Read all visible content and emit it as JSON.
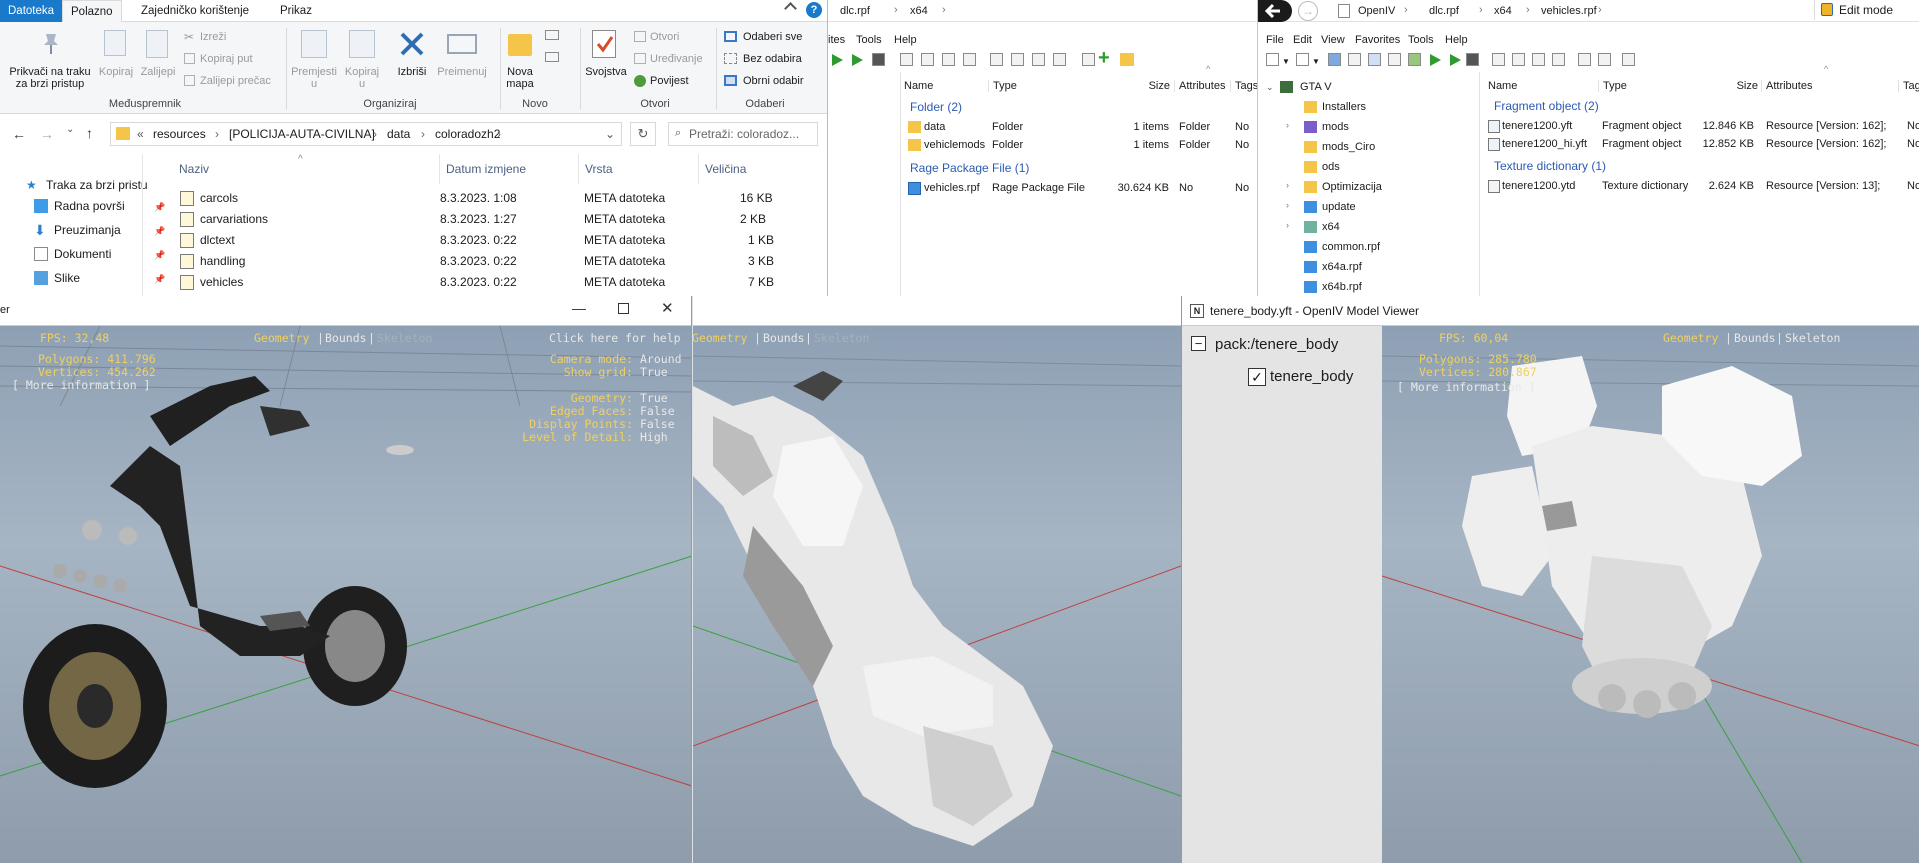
{
  "explorer": {
    "tabs": [
      "Datoteka",
      "Polazno",
      "Zajedničko korištenje",
      "Prikaz"
    ],
    "ribbon": {
      "pin_label": "Prikvači na traku\nza brzi pristup",
      "copy": "Kopiraj",
      "paste": "Zalijepi",
      "cut": "Izreži",
      "copy_path": "Kopiraj put",
      "paste_shortcut": "Zalijepi prečac",
      "group_clipboard": "Međuspremnik",
      "move_to": "Premjesti\nu",
      "copy_to": "Kopiraj\nu",
      "delete": "Izbriši",
      "rename": "Preimenuj",
      "group_organize": "Organiziraj",
      "new_folder": "Nova\nmapa",
      "group_new": "Novo",
      "properties": "Svojstva",
      "open": "Otvori",
      "edit": "Uređivanje",
      "history": "Povijest",
      "group_open": "Otvori",
      "select_all": "Odaberi sve",
      "select_none": "Bez odabira",
      "invert_selection": "Obrni odabir",
      "group_select": "Odaberi"
    },
    "address": {
      "chevrons": "«",
      "crumbs": [
        "resources",
        "[POLICIJA-AUTA-CIVILNA]",
        "data",
        "coloradozh2"
      ],
      "search_placeholder": "Pretraži: coloradoz..."
    },
    "nav": [
      {
        "label": "Traka za brzi pristu"
      },
      {
        "label": "Radna površi"
      },
      {
        "label": "Preuzimanja"
      },
      {
        "label": "Dokumenti"
      },
      {
        "label": "Slike"
      }
    ],
    "columns": [
      "Naziv",
      "Datum izmjene",
      "Vrsta",
      "Veličina"
    ],
    "files": [
      {
        "name": "carcols",
        "date": "8.3.2023. 1:08",
        "type": "META datoteka",
        "size": "16 KB"
      },
      {
        "name": "carvariations",
        "date": "8.3.2023. 1:27",
        "type": "META datoteka",
        "size": "2 KB"
      },
      {
        "name": "dlctext",
        "date": "8.3.2023. 0:22",
        "type": "META datoteka",
        "size": "1 KB"
      },
      {
        "name": "handling",
        "date": "8.3.2023. 0:22",
        "type": "META datoteka",
        "size": "3 KB"
      },
      {
        "name": "vehicles",
        "date": "8.3.2023. 0:22",
        "type": "META datoteka",
        "size": "7 KB"
      }
    ]
  },
  "openiv1": {
    "path": [
      "dlc.rpf",
      "x64"
    ],
    "menu": [
      "ites",
      "Tools",
      "Help"
    ],
    "columns": [
      "Name",
      "Type",
      "Size",
      "Attributes",
      "Tags"
    ],
    "group_folder": "Folder (2)",
    "folders": [
      {
        "name": "data",
        "type": "Folder",
        "size": "1 items",
        "attr": "Folder",
        "tags": "No"
      },
      {
        "name": "vehiclemods",
        "type": "Folder",
        "size": "1 items",
        "attr": "Folder",
        "tags": "No"
      }
    ],
    "group_rpf": "Rage Package File (1)",
    "rpfs": [
      {
        "name": "vehicles.rpf",
        "type": "Rage Package File",
        "size": "30.624 KB",
        "attr": "No",
        "tags": "No"
      }
    ]
  },
  "openiv2": {
    "path": [
      "OpenIV",
      "dlc.rpf",
      "x64",
      "vehicles.rpf"
    ],
    "edit_mode": "Edit mode",
    "menu": [
      "File",
      "Edit",
      "View",
      "Favorites",
      "Tools",
      "Help"
    ],
    "tree_root": "GTA V",
    "tree": [
      "Installers",
      "mods",
      "mods_Ciro",
      "ods",
      "Optimizacija",
      "update",
      "x64",
      "common.rpf",
      "x64a.rpf",
      "x64b.rpf"
    ],
    "columns": [
      "Name",
      "Type",
      "Size",
      "Attributes",
      "Tags"
    ],
    "group_fragment": "Fragment object (2)",
    "fragments": [
      {
        "name": "tenere1200.yft",
        "type": "Fragment object",
        "size": "12.846 KB",
        "attr": "Resource [Version: 162];",
        "tags": "No"
      },
      {
        "name": "tenere1200_hi.yft",
        "type": "Fragment object",
        "size": "12.852 KB",
        "attr": "Resource [Version: 162];",
        "tags": "No"
      }
    ],
    "group_texture": "Texture dictionary (1)",
    "textures": [
      {
        "name": "tenere1200.ytd",
        "type": "Texture dictionary",
        "size": "2.624 KB",
        "attr": "Resource [Version: 13];",
        "tags": "No"
      }
    ]
  },
  "viewer1": {
    "title": "er",
    "fps": "FPS: 32,48",
    "tabs": [
      "Geometry",
      "Bounds",
      "Skeleton"
    ],
    "help": "Click here for help",
    "polygons": "Polygons: 411.796",
    "vertices": "Vertices: 454.262",
    "more": "[ More information ]",
    "camera_mode_label": "Camera mode:",
    "camera_mode_value": "Around",
    "show_grid_label": "Show grid:",
    "show_grid_value": "True",
    "geometry_label": "Geometry:",
    "geometry_value": "True",
    "edged_label": "Edged Faces:",
    "edged_value": "False",
    "points_label": "Display Points:",
    "points_value": "False",
    "lod_label": "Level of Detail:",
    "lod_value": "High"
  },
  "viewer2": {
    "tabs": [
      "Geometry",
      "Bounds",
      "Skeleton"
    ]
  },
  "viewer3": {
    "title": "tenere_body.yft - OpenIV Model Viewer",
    "tree_root": "pack:/tenere_body",
    "tree_child": "tenere_body",
    "fps": "FPS: 60,04",
    "tabs": [
      "Geometry",
      "Bounds",
      "Skeleton"
    ],
    "polygons": "Polygons: 285.780",
    "vertices": "Vertices: 280.867",
    "more": "[ More information ]"
  }
}
